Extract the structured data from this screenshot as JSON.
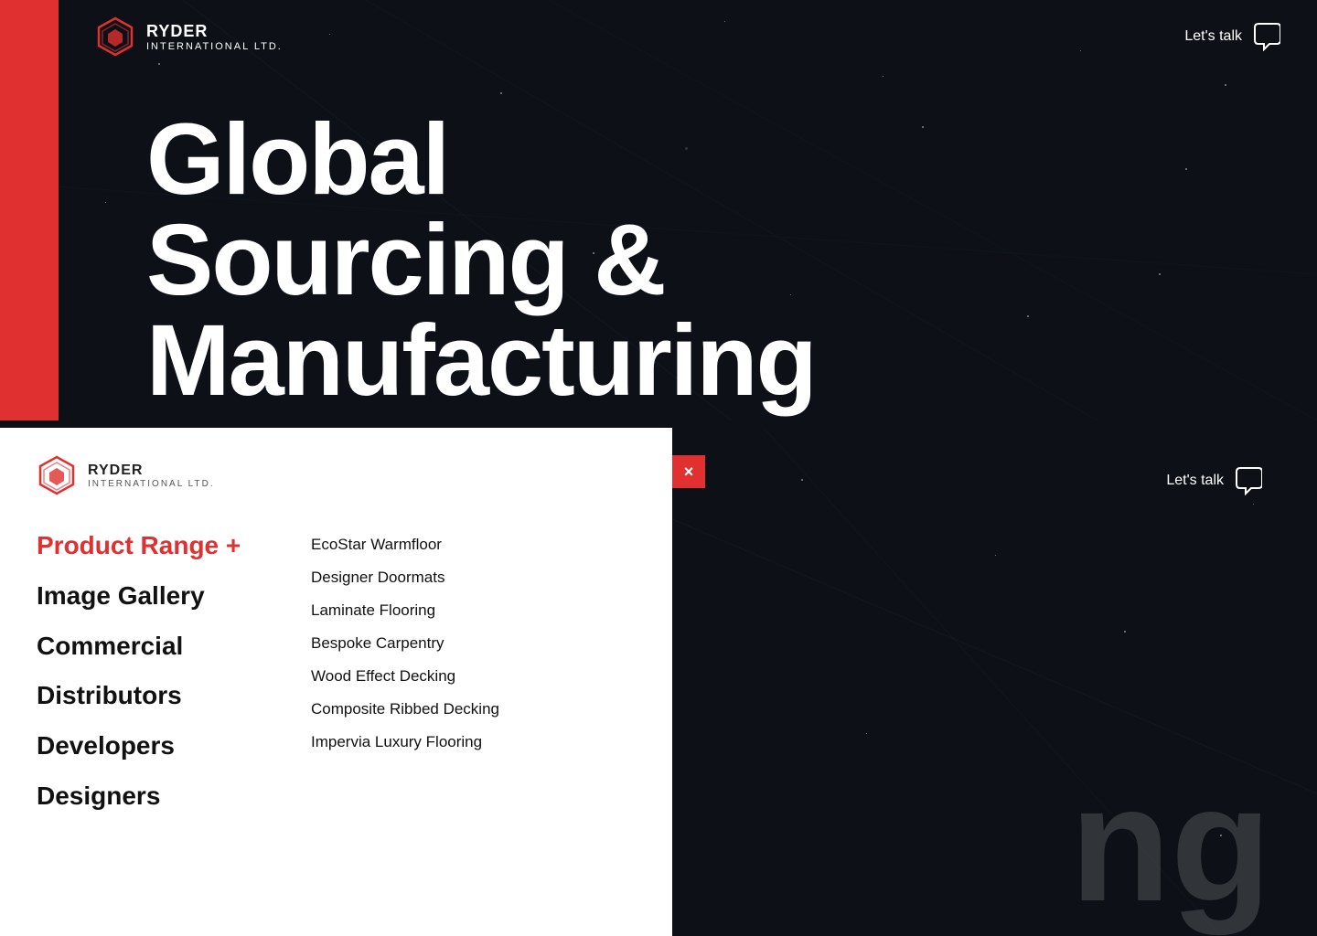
{
  "brand": {
    "name": "RYDER",
    "sub": "INTERNATIONAL LTD.",
    "tagline": "Let's talk"
  },
  "hero": {
    "headline_line1": "Global",
    "headline_line2": "Sourcing &",
    "headline_line3": "Manufacturing"
  },
  "nav": {
    "product_range_label": "Product Range +",
    "image_gallery_label": "Image Gallery",
    "commercial_label": "Commercial",
    "distributors_label": "Distributors",
    "developers_label": "Developers",
    "designers_label": "Designers",
    "close_label": "×"
  },
  "submenu": {
    "items": [
      "EcoStar Warmfloor",
      "Designer Doormats",
      "Laminate Flooring",
      "Bespoke Carpentry",
      "Wood Effect Decking",
      "Composite Ribbed Decking",
      "Impervia Luxury Flooring"
    ]
  },
  "lets_talk": "Let's talk",
  "big_bg_text": "ng",
  "colors": {
    "red": "#e03030",
    "dark_bg": "#0d1117",
    "white": "#ffffff"
  }
}
